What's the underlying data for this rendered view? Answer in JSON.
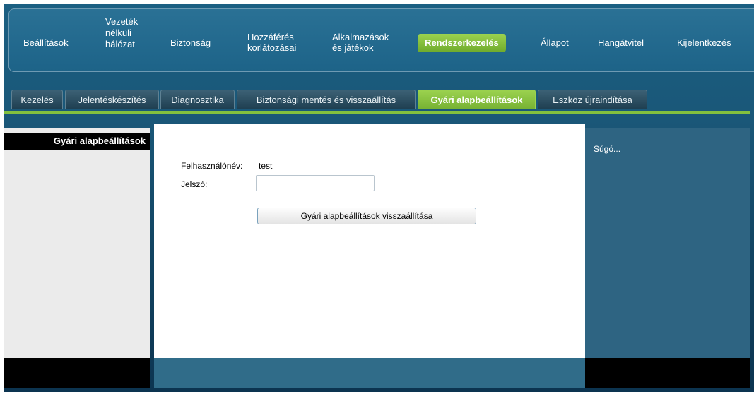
{
  "main_nav": [
    {
      "label": "Beállítások"
    },
    {
      "label": "Vezeték\nnélküli\nhálózat"
    },
    {
      "label": "Biztonság"
    },
    {
      "label": "Hozzáférés\nkorlátozásai"
    },
    {
      "label": "Alkalmazások\nés játékok"
    },
    {
      "label": "Rendszerkezelés"
    },
    {
      "label": "Állapot"
    },
    {
      "label": "Hangátvitel"
    },
    {
      "label": "Kijelentkezés"
    }
  ],
  "sub_tabs": [
    {
      "label": "Kezelés"
    },
    {
      "label": "Jelentéskészítés"
    },
    {
      "label": "Diagnosztika"
    },
    {
      "label": "Biztonsági mentés és visszaállítás"
    },
    {
      "label": "Gyári alapbeállítások"
    },
    {
      "label": "Eszköz újraindítása"
    }
  ],
  "left_panel": {
    "title": "Gyári alapbeállítások"
  },
  "form": {
    "username_label": "Felhasználónév:",
    "username_value": "test",
    "password_label": "Jelszó:",
    "password_value": "",
    "reset_button": "Gyári alapbeállítások visszaállítása"
  },
  "help": {
    "text": "Súgó..."
  },
  "colors": {
    "accent_green": "#83c03e",
    "nav_blue": "#1d6388",
    "help_blue": "#2e6482"
  }
}
